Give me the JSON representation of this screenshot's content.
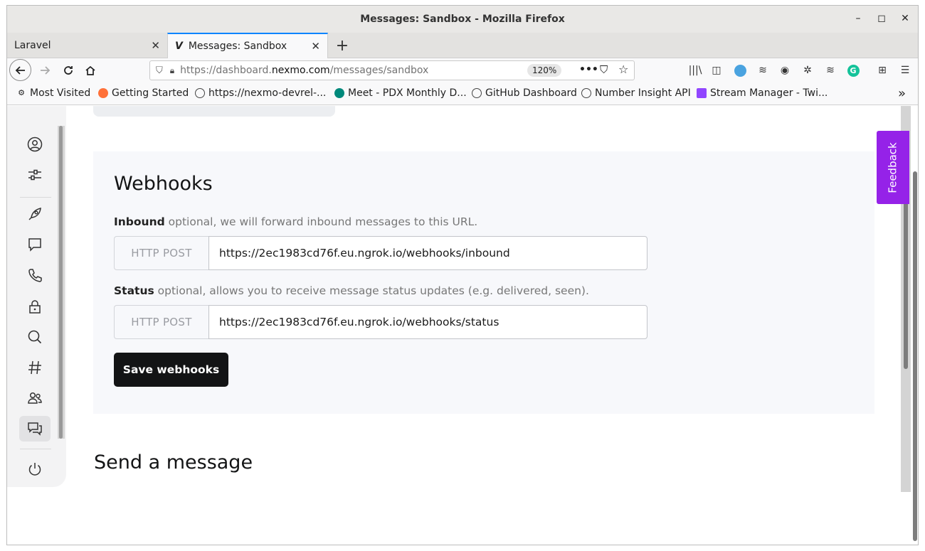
{
  "window": {
    "title": "Messages: Sandbox - Mozilla Firefox"
  },
  "tabs": [
    {
      "label": "Laravel"
    },
    {
      "label": "Messages: Sandbox"
    }
  ],
  "navbar": {
    "url_prefix": "https://dashboard.",
    "url_domain": "nexmo.com",
    "url_path": "/messages/sandbox",
    "zoom": "120%"
  },
  "bookmarks": [
    {
      "label": "Most Visited",
      "icon": "gear-icon"
    },
    {
      "label": "Getting Started",
      "icon": "firefox-icon"
    },
    {
      "label": "https://nexmo-devrel-...",
      "icon": "globe-icon"
    },
    {
      "label": "Meet - PDX Monthly D...",
      "icon": "meet-icon"
    },
    {
      "label": "GitHub Dashboard",
      "icon": "github-icon"
    },
    {
      "label": "Number Insight API",
      "icon": "globe-icon"
    },
    {
      "label": "Stream Manager - Twi...",
      "icon": "twitch-icon"
    }
  ],
  "webhooks": {
    "title": "Webhooks",
    "inbound": {
      "label": "Inbound",
      "hint": " optional, we will forward inbound messages to this URL.",
      "method": "HTTP POST",
      "value": "https://2ec1983cd76f.eu.ngrok.io/webhooks/inbound"
    },
    "status": {
      "label": "Status",
      "hint": " optional, allows you to receive message status updates (e.g. delivered, seen).",
      "method": "HTTP POST",
      "value": "https://2ec1983cd76f.eu.ngrok.io/webhooks/status"
    },
    "save_label": "Save webhooks"
  },
  "send": {
    "title": "Send a message"
  },
  "feedback": {
    "label": "Feedback"
  },
  "colors": {
    "accent": "#9522e8",
    "button": "#131415",
    "tab_highlight": "#0a84ff"
  }
}
